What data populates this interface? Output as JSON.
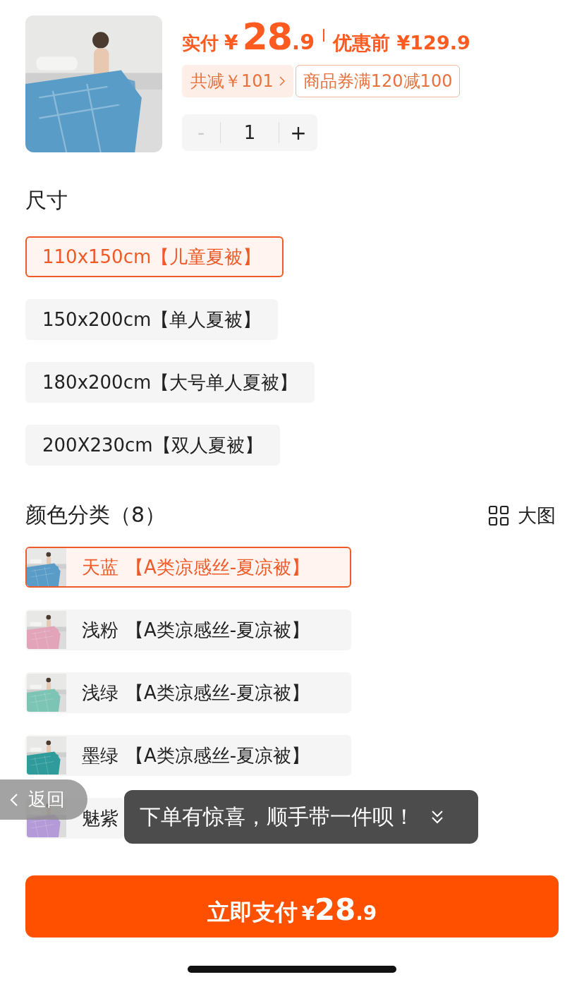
{
  "product": {
    "price": {
      "label": "实付",
      "currency": "¥",
      "integer": "28",
      "decimal": ".9"
    },
    "original_price": {
      "label": "优惠前",
      "value": "¥129.9"
    },
    "discount": {
      "text": "共减￥101"
    },
    "coupon": {
      "text": "商品券满120减100"
    },
    "stepper": {
      "minus": "-",
      "value": "1",
      "plus": "+",
      "minus_disabled": true
    }
  },
  "size_section": {
    "title": "尺寸",
    "options": [
      {
        "label": "110x150cm【儿童夏被】",
        "selected": true
      },
      {
        "label": "150x200cm【单人夏被】",
        "selected": false
      },
      {
        "label": "180x200cm【大号单人夏被】",
        "selected": false
      },
      {
        "label": "200X230cm【双人夏被】",
        "selected": false
      }
    ]
  },
  "color_section": {
    "title": "颜色分类（8）",
    "view_toggle": "大图",
    "options": [
      {
        "name": "天蓝",
        "label": "【A类凉感丝-夏凉被】",
        "selected": true
      },
      {
        "name": "浅粉",
        "label": "【A类凉感丝-夏凉被】",
        "selected": false
      },
      {
        "name": "浅绿",
        "label": "【A类凉感丝-夏凉被】",
        "selected": false
      },
      {
        "name": "墨绿",
        "label": "【A类凉感丝-夏凉被】",
        "selected": false
      },
      {
        "name": "魅紫",
        "selected": false
      }
    ]
  },
  "back_button": {
    "label": "返回"
  },
  "toast": {
    "text": "下单有惊喜，顺手带一件呗！"
  },
  "pay_button": {
    "label": "立即支付",
    "currency": "¥",
    "integer": "28",
    "decimal": ".9"
  }
}
